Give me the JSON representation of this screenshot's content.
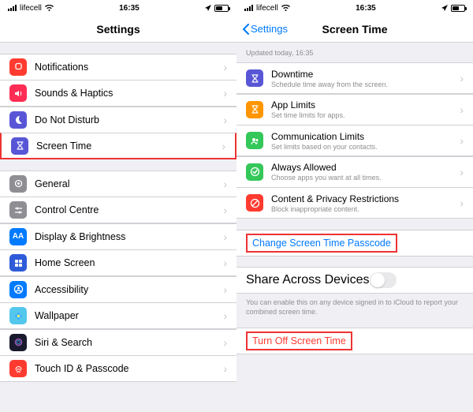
{
  "status": {
    "carrier": "lifecell",
    "time": "16:35"
  },
  "left": {
    "title": "Settings",
    "groups": [
      [
        {
          "key": "notifications",
          "label": "Notifications",
          "bg": "#ff3b30",
          "icon": "bell"
        },
        {
          "key": "sounds",
          "label": "Sounds & Haptics",
          "bg": "#ff2d55",
          "icon": "speaker"
        },
        {
          "key": "dnd",
          "label": "Do Not Disturb",
          "bg": "#5856d6",
          "icon": "moon"
        },
        {
          "key": "screentime",
          "label": "Screen Time",
          "bg": "#5856d6",
          "icon": "hourglass",
          "highlight": true
        }
      ],
      [
        {
          "key": "general",
          "label": "General",
          "bg": "#8e8e93",
          "icon": "gear"
        },
        {
          "key": "control",
          "label": "Control Centre",
          "bg": "#8e8e93",
          "icon": "sliders"
        },
        {
          "key": "display",
          "label": "Display & Brightness",
          "bg": "#007aff",
          "icon": "AA"
        },
        {
          "key": "home",
          "label": "Home Screen",
          "bg": "#2f5bd9",
          "icon": "grid"
        },
        {
          "key": "accessibility",
          "label": "Accessibility",
          "bg": "#007aff",
          "icon": "person"
        },
        {
          "key": "wallpaper",
          "label": "Wallpaper",
          "bg": "#54c7ec",
          "icon": "flower"
        },
        {
          "key": "siri",
          "label": "Siri & Search",
          "bg": "#1a1a2e",
          "icon": "siri"
        },
        {
          "key": "touchid",
          "label": "Touch ID & Passcode",
          "bg": "#ff3b30",
          "icon": "fingerprint"
        }
      ]
    ]
  },
  "right": {
    "back": "Settings",
    "title": "Screen Time",
    "updated": "Updated today, 16:35",
    "items": [
      {
        "key": "downtime",
        "label": "Downtime",
        "sub": "Schedule time away from the screen.",
        "bg": "#5856d6",
        "icon": "hourglass"
      },
      {
        "key": "applimits",
        "label": "App Limits",
        "sub": "Set time limits for apps.",
        "bg": "#ff9500",
        "icon": "hourglass"
      },
      {
        "key": "commlimits",
        "label": "Communication Limits",
        "sub": "Set limits based on your contacts.",
        "bg": "#34c759",
        "icon": "people"
      },
      {
        "key": "allowed",
        "label": "Always Allowed",
        "sub": "Choose apps you want at all times.",
        "bg": "#34c759",
        "icon": "check"
      },
      {
        "key": "content",
        "label": "Content & Privacy Restrictions",
        "sub": "Block inappropriate content.",
        "bg": "#ff3b30",
        "icon": "no"
      }
    ],
    "change_passcode": "Change Screen Time Passcode",
    "share_across": "Share Across Devices",
    "share_footer": "You can enable this on any device signed in to iCloud to report your combined screen time.",
    "turn_off": "Turn Off Screen Time"
  }
}
